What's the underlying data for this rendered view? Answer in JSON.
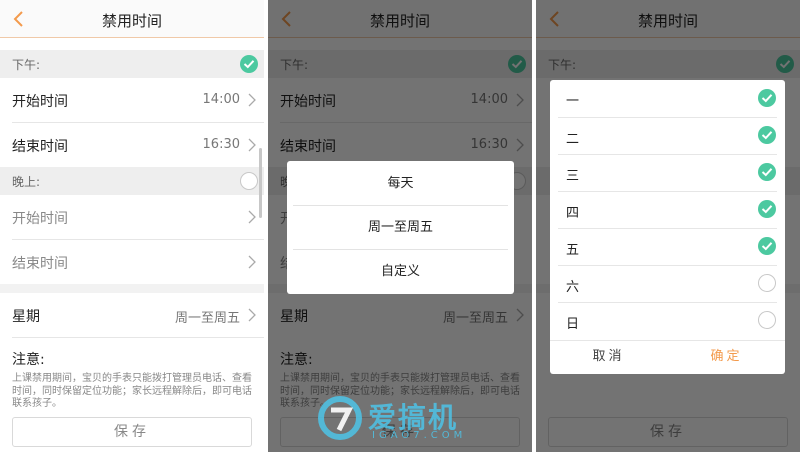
{
  "header": {
    "title": "禁用时间"
  },
  "sections": {
    "afternoon": {
      "label": "下午:",
      "start_label": "开始时间",
      "start_value": "14:00",
      "end_label": "结束时间",
      "end_value": "16:30"
    },
    "evening": {
      "label": "晚上:",
      "start_label": "开始时间",
      "end_label": "结束时间"
    }
  },
  "week": {
    "label": "星期",
    "value": "周一至周五"
  },
  "note": {
    "title": "注意:",
    "text": "上课禁用期间，宝贝的手表只能拨打管理员电话、查看时间，同时保留定位功能；家长远程解除后，即可电话联系孩子。"
  },
  "save_label": "保存",
  "repeat_dialog": {
    "options": [
      "每天",
      "周一至周五",
      "自定义"
    ]
  },
  "days_dialog": {
    "days": [
      {
        "name": "一",
        "checked": true
      },
      {
        "name": "二",
        "checked": true
      },
      {
        "name": "三",
        "checked": true
      },
      {
        "name": "四",
        "checked": true
      },
      {
        "name": "五",
        "checked": true
      },
      {
        "name": "六",
        "checked": false
      },
      {
        "name": "日",
        "checked": false
      }
    ],
    "cancel_label": "取消",
    "confirm_label": "确定"
  },
  "watermark": {
    "brand": "爱搞机",
    "domain": "IGAO7.COM"
  },
  "colors": {
    "accent": "#f39a4c",
    "check": "#4cc9a0",
    "watermark": "#4ec4e8"
  }
}
